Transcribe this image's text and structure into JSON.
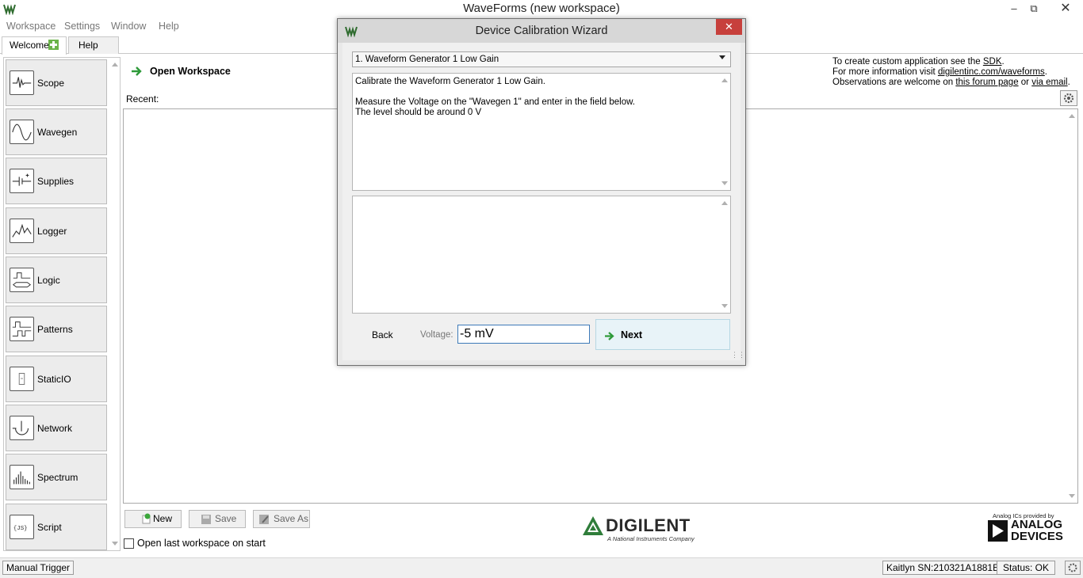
{
  "window": {
    "title": "WaveForms  (new workspace)"
  },
  "menu": [
    "Workspace",
    "Settings",
    "Window",
    "Help"
  ],
  "tabs": [
    "Welcome",
    "Help"
  ],
  "sidebar": [
    {
      "label": "Scope",
      "icon": "scope-icon"
    },
    {
      "label": "Wavegen",
      "icon": "wavegen-icon"
    },
    {
      "label": "Supplies",
      "icon": "supplies-icon"
    },
    {
      "label": "Logger",
      "icon": "logger-icon"
    },
    {
      "label": "Logic",
      "icon": "logic-icon"
    },
    {
      "label": "Patterns",
      "icon": "patterns-icon"
    },
    {
      "label": "StaticIO",
      "icon": "staticio-icon"
    },
    {
      "label": "Network",
      "icon": "network-icon"
    },
    {
      "label": "Spectrum",
      "icon": "spectrum-icon"
    },
    {
      "label": "Script",
      "icon": "script-icon"
    }
  ],
  "main": {
    "open_workspace": "Open Workspace",
    "recent": "Recent:",
    "info": {
      "line1_text": "To create custom application see the ",
      "line1_link": "SDK",
      "line1_end": ".",
      "line2_text": "For more information visit ",
      "line2_link": "digilentinc.com/waveforms",
      "line2_end": ".",
      "line3_text": "Observations are welcome on ",
      "line3_link1": "this forum page",
      "line3_mid": " or ",
      "line3_link2": "via email",
      "line3_end": "."
    },
    "buttons": {
      "new": "New",
      "save": "Save",
      "save_as": "Save As"
    },
    "open_last": "Open last workspace on start",
    "digilent": {
      "name": "DIGILENT",
      "sub": "A National Instruments Company"
    },
    "adi": {
      "provided": "Analog ICs provided by",
      "name1": "ANALOG",
      "name2": "DEVICES"
    }
  },
  "status": {
    "trigger": "Manual Trigger",
    "device": "Kaitlyn SN:210321A1881E",
    "status": "Status: OK"
  },
  "dialog": {
    "title": "Device Calibration Wizard",
    "step": "1. Waveform Generator 1 Low Gain",
    "instructions": [
      "Calibrate the Waveform Generator 1 Low Gain.",
      "",
      "Measure the Voltage on the \"Wavegen 1\" and enter in the field below.",
      "The level should be around 0 V"
    ],
    "back": "Back",
    "voltage_label": "Voltage:",
    "voltage_value": "-5 mV",
    "next": "Next"
  }
}
